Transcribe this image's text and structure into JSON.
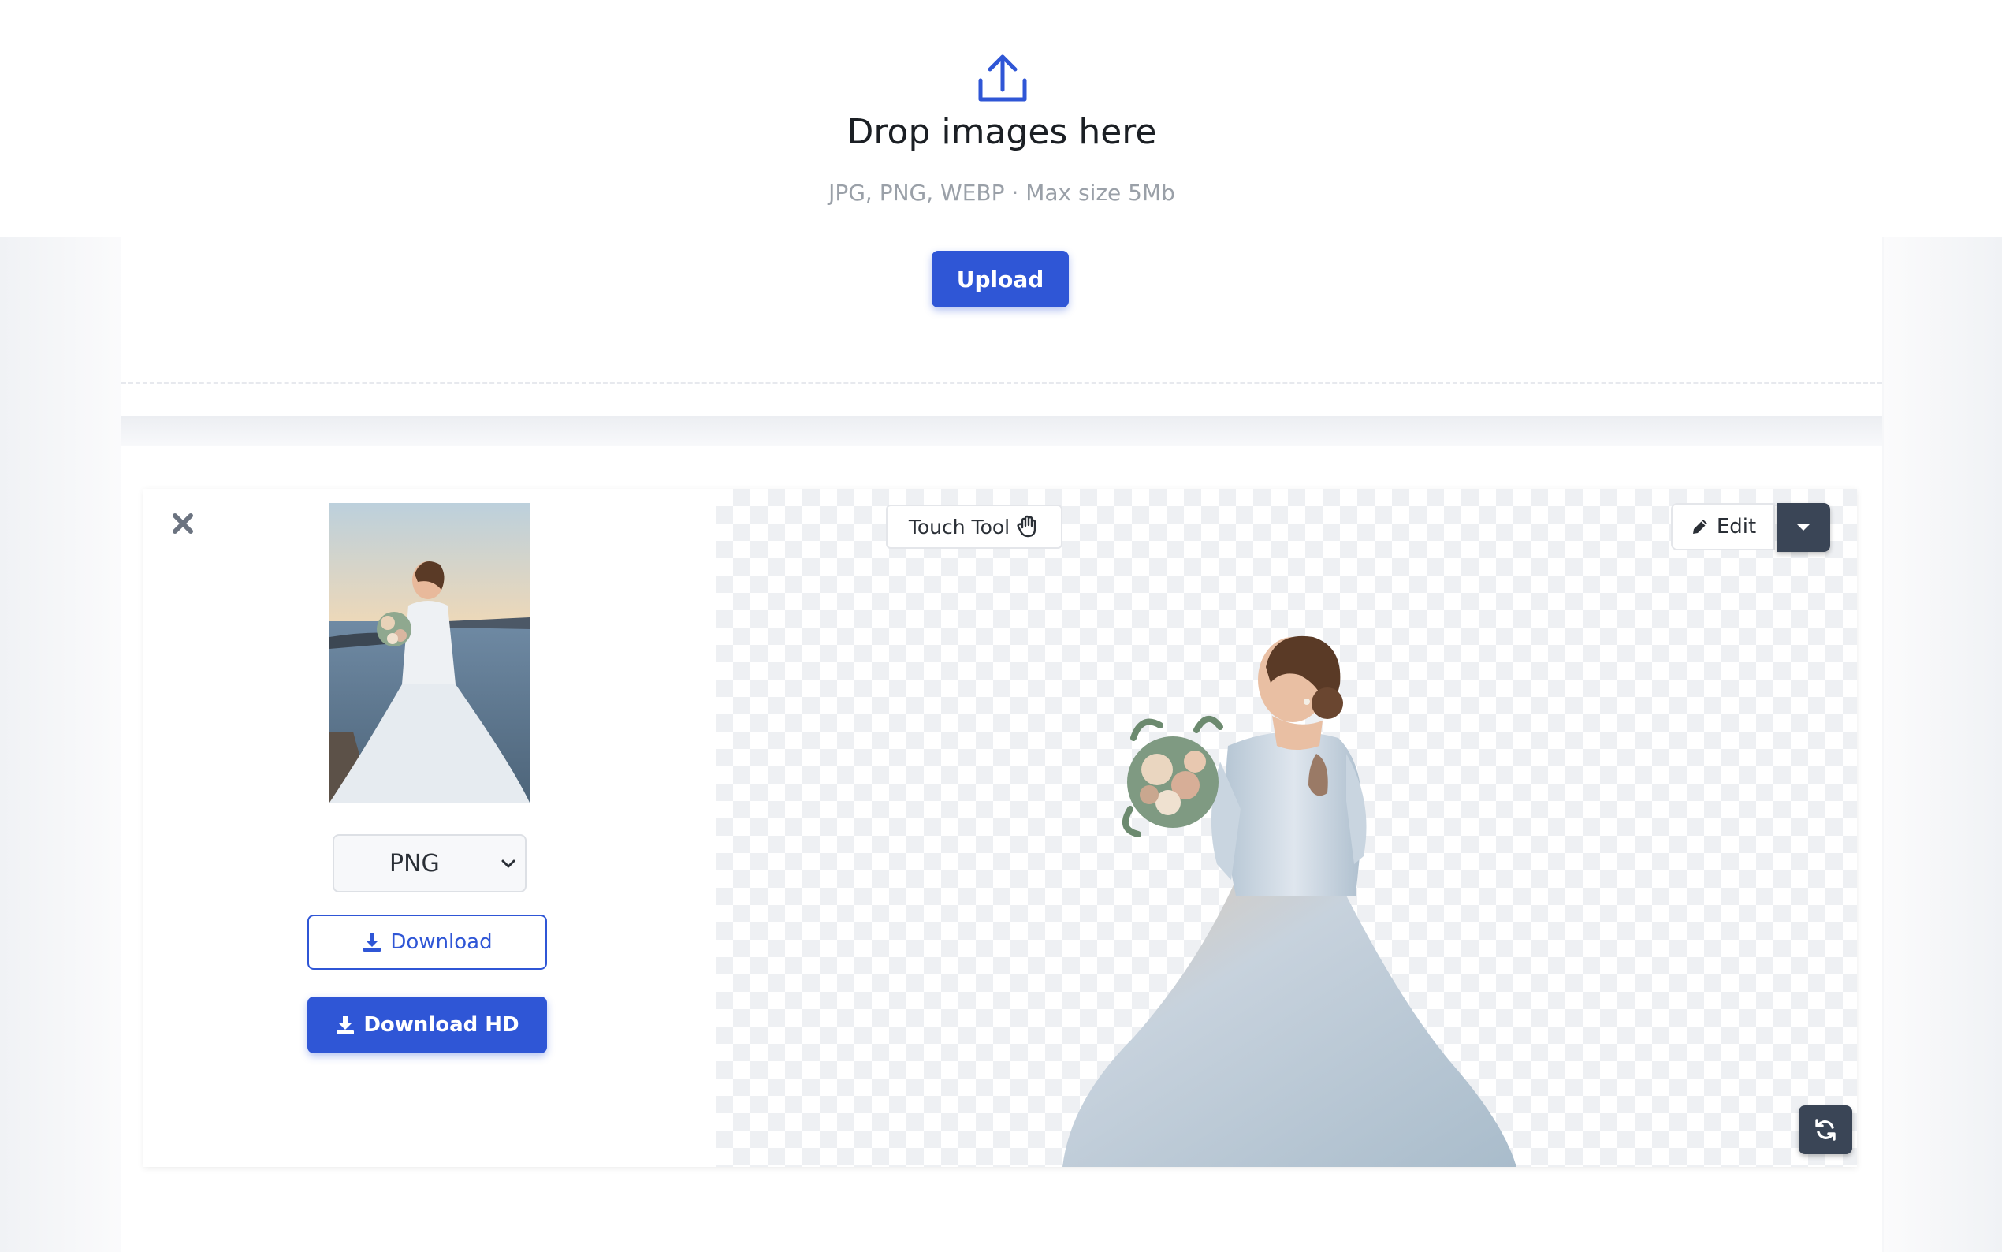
{
  "dropzone": {
    "title": "Drop images here",
    "subtitle": "JPG, PNG, WEBP · Max size 5Mb",
    "upload_label": "Upload",
    "icon": "upload-icon"
  },
  "result": {
    "close_icon": "close-icon",
    "format": {
      "selected": "PNG"
    },
    "download_label": "Download",
    "download_hd_label": "Download HD",
    "touch_tool_label": "Touch Tool",
    "edit_label": "Edit"
  },
  "colors": {
    "accent": "#2f56d6",
    "dark_button": "#3a4556",
    "muted_text": "#9aa0a8"
  }
}
